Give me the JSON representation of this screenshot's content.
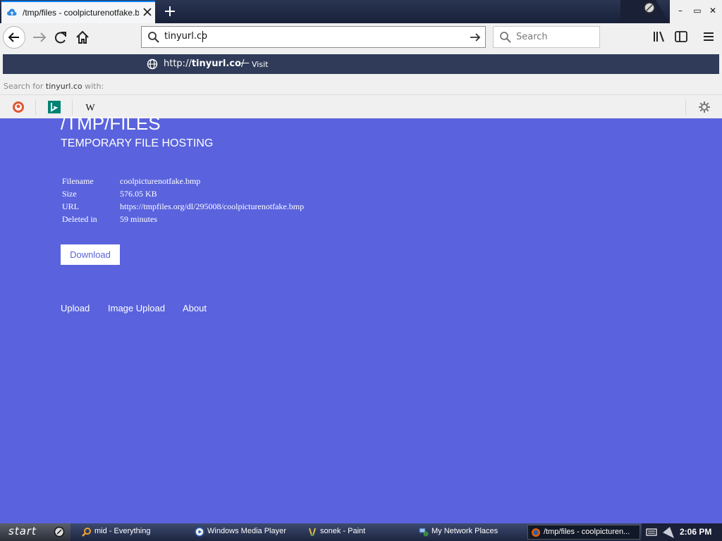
{
  "browser": {
    "tab": {
      "title": "/tmp/files - coolpicturenotfake.bmp"
    },
    "window_controls": {
      "minimize": "–",
      "restore": "▭",
      "close": "✕"
    },
    "urlbar": {
      "value": "tinyurl.co"
    },
    "search": {
      "placeholder": "Search"
    }
  },
  "dropdown": {
    "suggestion": {
      "url_prefix": "http://",
      "url_host": "tinyurl.co",
      "url_suffix": "/",
      "dash": "—",
      "action": "Visit"
    },
    "search_for": {
      "prefix": "Search for",
      "query": "tinyurl.co",
      "suffix": "with:"
    },
    "engines": [
      "duckduckgo",
      "bing",
      "wikipedia"
    ]
  },
  "page": {
    "title": "/TMP/FILES",
    "subtitle": "TEMPORARY FILE HOSTING",
    "file_info": [
      {
        "label": "Filename",
        "value": "coolpicturenotfake.bmp"
      },
      {
        "label": "Size",
        "value": "576.05 KB"
      },
      {
        "label": "URL",
        "value": "https://tmpfiles.org/dl/295008/coolpicturenotfake.bmp"
      },
      {
        "label": "Deleted in",
        "value": "59 minutes"
      }
    ],
    "download_label": "Download",
    "footer_links": [
      "Upload",
      "Image Upload",
      "About"
    ],
    "colors": {
      "background": "#5a63dd",
      "text": "#ffffff"
    }
  },
  "taskbar": {
    "start": "start",
    "tasks": [
      {
        "title": "mid - Everything",
        "icon": "search-icon"
      },
      {
        "title": "Windows Media Player",
        "icon": "media-player-icon"
      },
      {
        "title": "sonek - Paint",
        "icon": "paint-icon"
      },
      {
        "title": "My Network Places",
        "icon": "network-icon"
      },
      {
        "title": "/tmp/files - coolpicturen...",
        "icon": "firefox-icon"
      }
    ],
    "clock": "2:06 PM"
  }
}
